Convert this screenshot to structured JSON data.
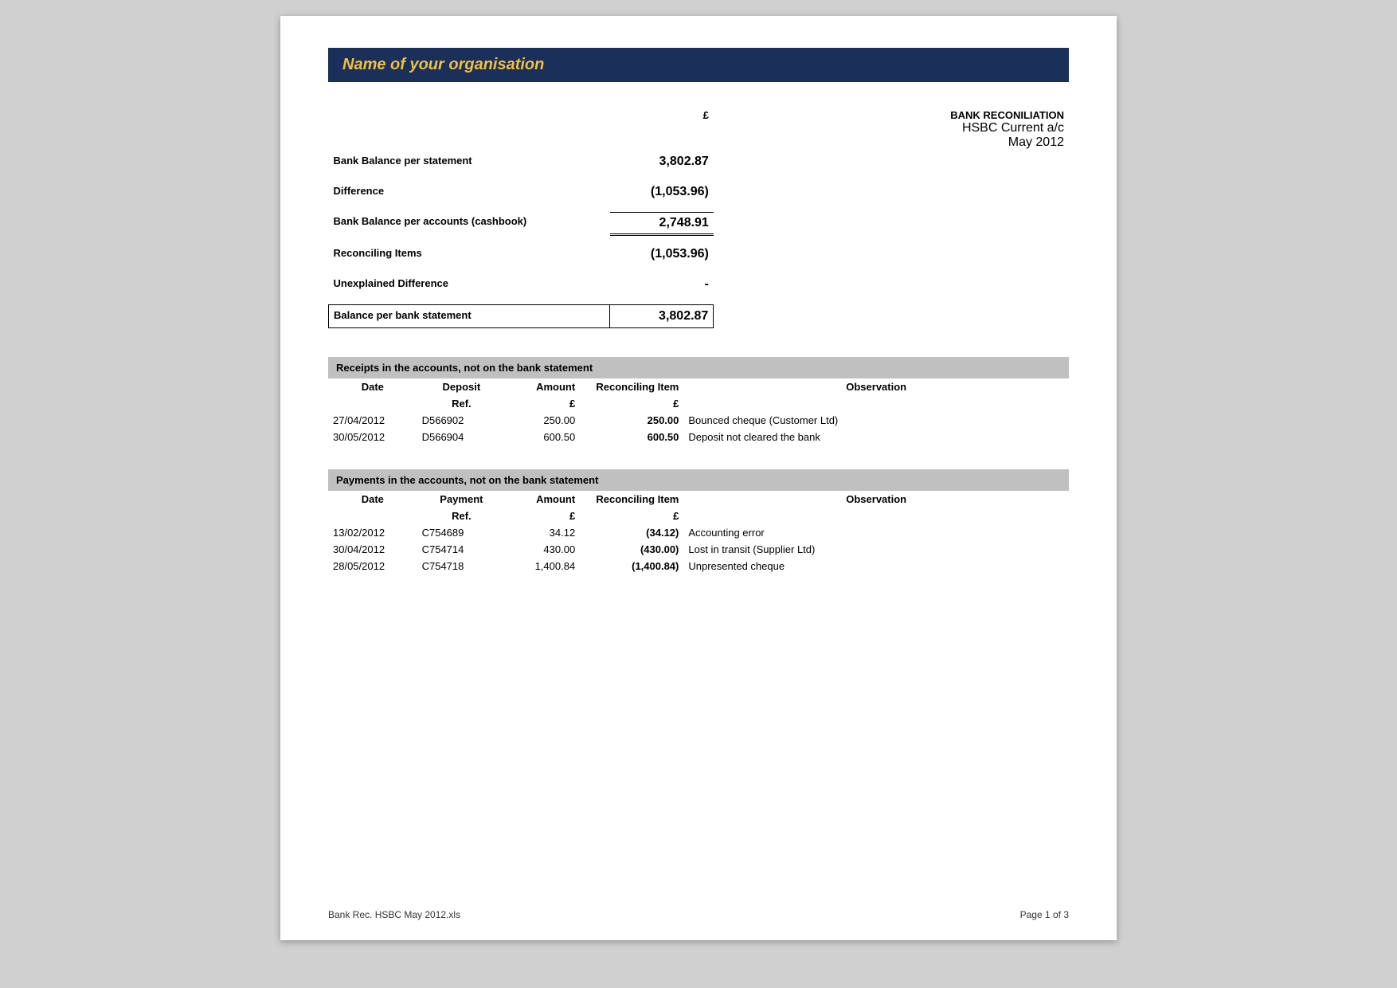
{
  "org": {
    "name": "Name of your organisation"
  },
  "report": {
    "currency_symbol": "£",
    "title": "BANK RECONILIATION",
    "subtitle1": "HSBC Current a/c",
    "subtitle2": "May 2012"
  },
  "summary": {
    "bank_balance_label": "Bank Balance per statement",
    "bank_balance_value": "3,802.87",
    "difference_label": "Difference",
    "difference_value": "(1,053.96)",
    "cashbook_label": "Bank Balance per accounts (cashbook)",
    "cashbook_value": "2,748.91",
    "reconciling_label": "Reconciling Items",
    "reconciling_value": "(1,053.96)",
    "unexplained_label": "Unexplained Difference",
    "unexplained_value": "-",
    "balance_bank_label": "Balance per bank statement",
    "balance_bank_value": "3,802.87"
  },
  "receipts": {
    "section_title": "Receipts in the accounts, not on the bank statement",
    "columns": {
      "date": "Date",
      "deposit": "Deposit",
      "ref_sub": "Ref.",
      "amount": "Amount",
      "amount_sub": "£",
      "recon": "Reconciling Item",
      "recon_sub": "£",
      "observation": "Observation"
    },
    "rows": [
      {
        "date": "27/04/2012",
        "ref": "D566902",
        "amount": "250.00",
        "recon": "250.00",
        "observation": "Bounced cheque (Customer Ltd)"
      },
      {
        "date": "30/05/2012",
        "ref": "D566904",
        "amount": "600.50",
        "recon": "600.50",
        "observation": "Deposit not cleared the bank"
      }
    ]
  },
  "payments": {
    "section_title": "Payments in the accounts, not on the bank statement",
    "columns": {
      "date": "Date",
      "payment": "Payment",
      "ref_sub": "Ref.",
      "amount": "Amount",
      "amount_sub": "£",
      "recon": "Reconciling Item",
      "recon_sub": "£",
      "observation": "Observation"
    },
    "rows": [
      {
        "date": "13/02/2012",
        "ref": "C754689",
        "amount": "34.12",
        "recon": "(34.12)",
        "observation": "Accounting error"
      },
      {
        "date": "30/04/2012",
        "ref": "C754714",
        "amount": "430.00",
        "recon": "(430.00)",
        "observation": "Lost in transit (Supplier Ltd)"
      },
      {
        "date": "28/05/2012",
        "ref": "C754718",
        "amount": "1,400.84",
        "recon": "(1,400.84)",
        "observation": "Unpresented cheque"
      }
    ]
  },
  "footer": {
    "file_name": "Bank Rec. HSBC May 2012.xls",
    "page_info": "Page 1 of 3"
  }
}
